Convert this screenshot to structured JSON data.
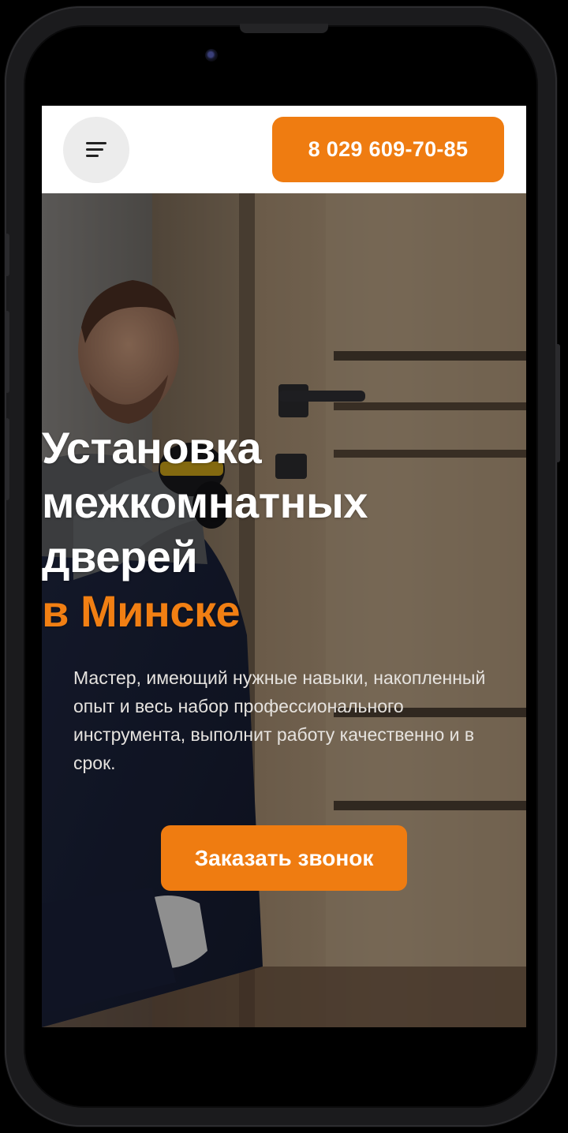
{
  "header": {
    "phone_label": "8 029 609-70-85",
    "menu_icon": "hamburger-menu-icon"
  },
  "hero": {
    "title_lines": [
      "Установка",
      "межкомнатных",
      "дверей"
    ],
    "title_accent": "в Минске",
    "description": "Мастер, имеющий нужные навыки, накопленный опыт и весь набор профессионального инструмента, выполнит работу качественно и в срок.",
    "cta_label": "Заказать звонок"
  },
  "colors": {
    "accent": "#ef7c11",
    "header_bg": "#ffffff",
    "menu_button_bg": "#ececec"
  }
}
